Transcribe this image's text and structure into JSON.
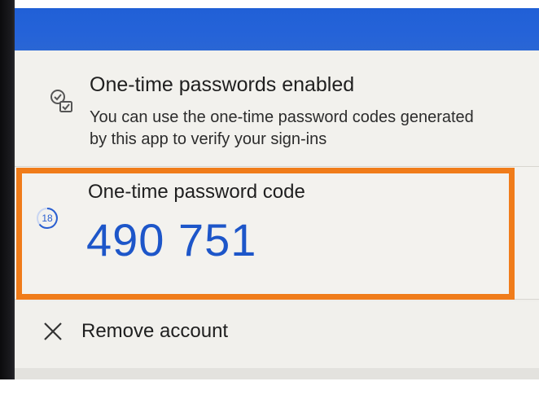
{
  "header": {
    "bar_color": "#2563d8"
  },
  "otp_enabled": {
    "icon": "checklist-icon",
    "title": "One-time passwords enabled",
    "description": "You can use the one-time password codes generated by this app to verify your sign-ins"
  },
  "otp_code": {
    "label": "One-time password code",
    "code": "490 751",
    "timer_seconds": "18",
    "timer_icon": "countdown-ring-icon",
    "highlight_color": "#f07c1a",
    "code_color": "#1d56c9"
  },
  "remove_account": {
    "icon": "close-icon",
    "label": "Remove account"
  }
}
